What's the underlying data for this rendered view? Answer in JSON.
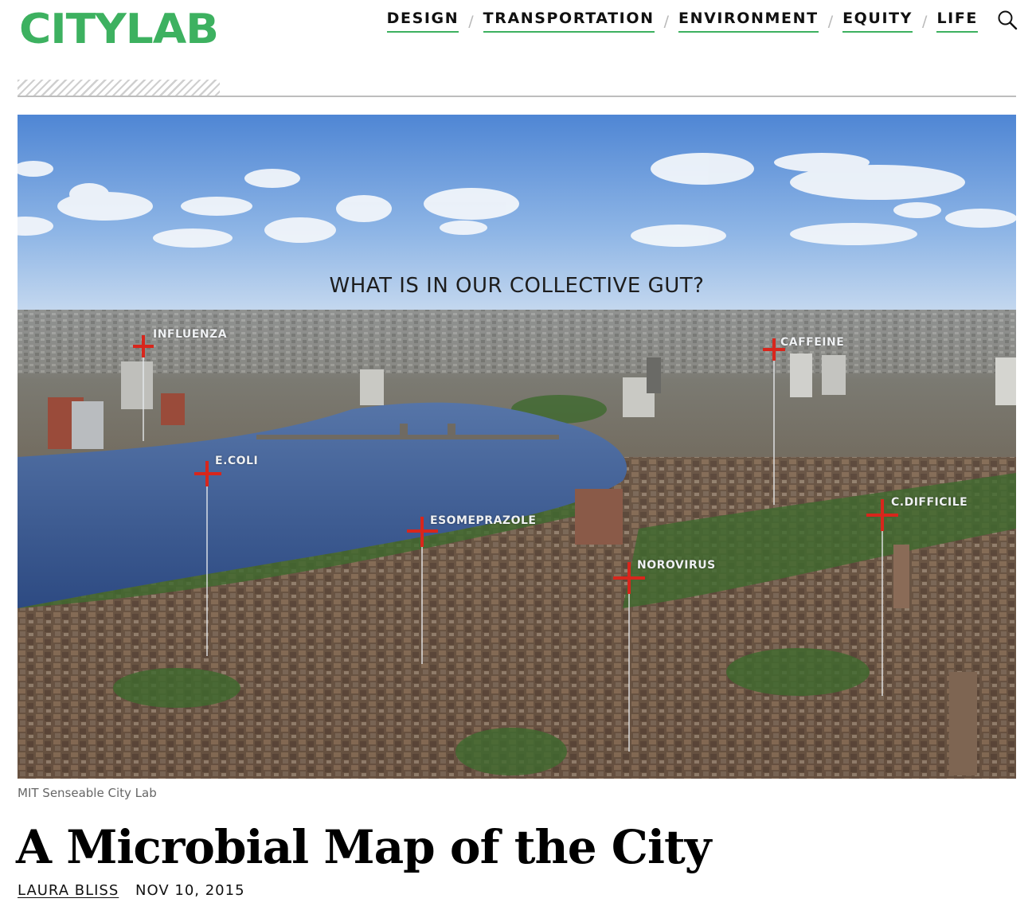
{
  "site": {
    "logo_text": "CITYLAB",
    "brand_color": "#3db160"
  },
  "nav": {
    "items": [
      {
        "label": "DESIGN"
      },
      {
        "label": "TRANSPORTATION"
      },
      {
        "label": "ENVIRONMENT"
      },
      {
        "label": "EQUITY"
      },
      {
        "label": "LIFE"
      }
    ],
    "separator": "/",
    "search_icon": "search-icon"
  },
  "hero": {
    "headline": "WHAT IS IN OUR COLLECTIVE GUT?",
    "markers": [
      "INFLUENZA",
      "CAFFEINE",
      "E.COLI",
      "ESOMEPRAZOLE",
      "C.DIFFICILE",
      "NOROVIRUS"
    ],
    "marker_color": "#d8261c"
  },
  "article": {
    "caption": "MIT Senseable City Lab",
    "title": "A Microbial Map of the City",
    "author": "LAURA BLISS",
    "date": "NOV 10, 2015"
  }
}
